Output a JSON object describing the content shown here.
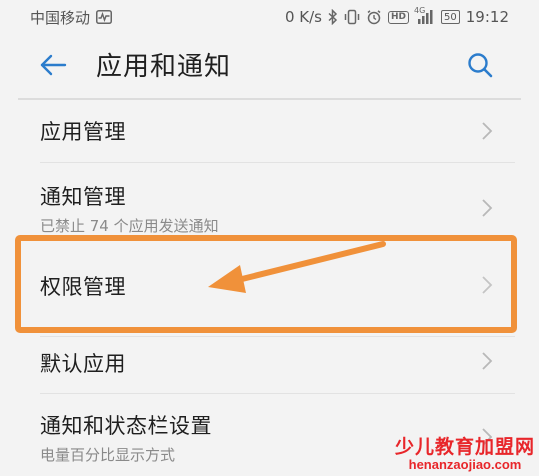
{
  "status_bar": {
    "carrier": "中国移动",
    "net_speed": "0 K/s",
    "battery": "50",
    "time": "19:12",
    "icons": [
      "activity-icon",
      "bluetooth-icon",
      "vibrate-icon",
      "alarm-icon",
      "hd-icon",
      "signal-icon",
      "battery-icon"
    ],
    "hd_label": "HD",
    "net_type": "4G"
  },
  "header": {
    "title": "应用和通知",
    "back_icon": "arrow-left-icon",
    "search_icon": "search-icon",
    "accent_color": "#2b7ccc"
  },
  "list": {
    "items": [
      {
        "title": "应用管理",
        "subtitle": ""
      },
      {
        "title": "通知管理",
        "subtitle": "已禁止 74 个应用发送通知"
      },
      {
        "title": "权限管理",
        "subtitle": ""
      },
      {
        "title": "默认应用",
        "subtitle": ""
      },
      {
        "title": "通知和状态栏设置",
        "subtitle": "电量百分比显示方式"
      }
    ],
    "chevron_icon": "chevron-right-icon"
  },
  "annotation": {
    "highlight_color": "#f0913a",
    "highlighted_item": "权限管理"
  },
  "watermark": {
    "cn": "少儿教育加盟网",
    "en": "henanzaojiao.com",
    "color": "#e8262a"
  }
}
